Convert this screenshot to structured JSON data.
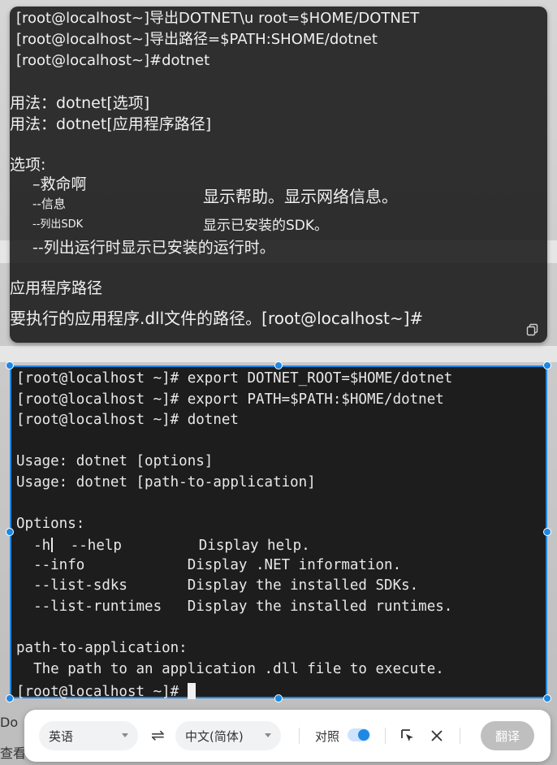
{
  "translation_overlay": {
    "lines": [
      "[root@localhost~]导出DOTNET\\u root=$HOME/DOTNET",
      "[root@localhost~]导出路径=$PATH:SHOME/dotnet",
      "[root@localhost~]#dotnet",
      "用法：dotnet[选项]",
      "用法：dotnet[应用程序路径]",
      "选项:",
      "–救命啊",
      "--信息",
      "--列出SDK",
      "--列出运行时显示已安装的运行时。",
      "显示帮助。显示网络信息。",
      "显示已安装的SDK。",
      "应用程序路径",
      "要执行的应用程序.dll文件的路径。[root@localhost~]#"
    ]
  },
  "terminal": {
    "lines": [
      "[root@localhost ~]# export DOTNET_ROOT=$HOME/dotnet",
      "[root@localhost ~]# export PATH=$PATH:$HOME/dotnet",
      "[root@localhost ~]# dotnet",
      "Usage: dotnet [options]",
      "Usage: dotnet [path-to-application]",
      "Options:",
      "  --help         Display help.",
      "  --info            Display .NET information.",
      "  --list-sdks       Display the installed SDKs.",
      "  --list-runtimes   Display the installed runtimes.",
      "path-to-application:",
      "  The path to an application .dll file to execute.",
      "[root@localhost ~]# "
    ],
    "help_prefix": "  -h"
  },
  "toolbar": {
    "source_lang": "英语",
    "swap_symbol": "⇌",
    "target_lang": "中文(简体)",
    "compare_label": "对照",
    "compare_enabled": true,
    "translate_label": "翻译"
  },
  "background": {
    "fragments": [
      "Do",
      "查看"
    ]
  },
  "colors": {
    "selection": "#1e88e5",
    "terminal_bg": "#1d1d1d",
    "overlay_bg": "#141414"
  }
}
